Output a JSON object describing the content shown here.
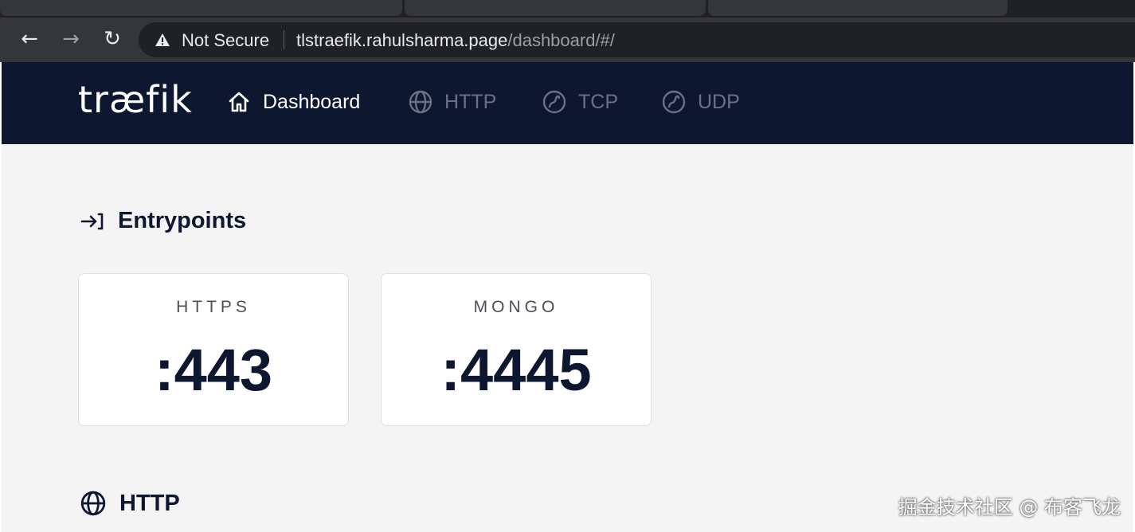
{
  "browser": {
    "security_label": "Not Secure",
    "url_host": "tlstraefik.rahulsharma.page",
    "url_path": "/dashboard/#/"
  },
  "header": {
    "logo": "træfik",
    "nav": [
      {
        "label": "Dashboard",
        "icon": "home-icon",
        "active": true
      },
      {
        "label": "HTTP",
        "icon": "globe-icon",
        "active": false
      },
      {
        "label": "TCP",
        "icon": "tcp-icon",
        "active": false
      },
      {
        "label": "UDP",
        "icon": "udp-icon",
        "active": false
      }
    ]
  },
  "entrypoints": {
    "title": "Entrypoints",
    "icon": "entrypoint-arrow-icon",
    "cards": [
      {
        "name": "HTTPS",
        "port": ":443"
      },
      {
        "name": "MONGO",
        "port": ":4445"
      }
    ]
  },
  "http_section": {
    "title": "HTTP",
    "icon": "globe-icon"
  },
  "watermark": "掘金技术社区 @ 布客飞龙",
  "colors": {
    "header_bg": "#0e1730",
    "main_bg": "#f4f4f4",
    "text_dark": "#0e1730",
    "nav_inactive": "#6b7184"
  }
}
